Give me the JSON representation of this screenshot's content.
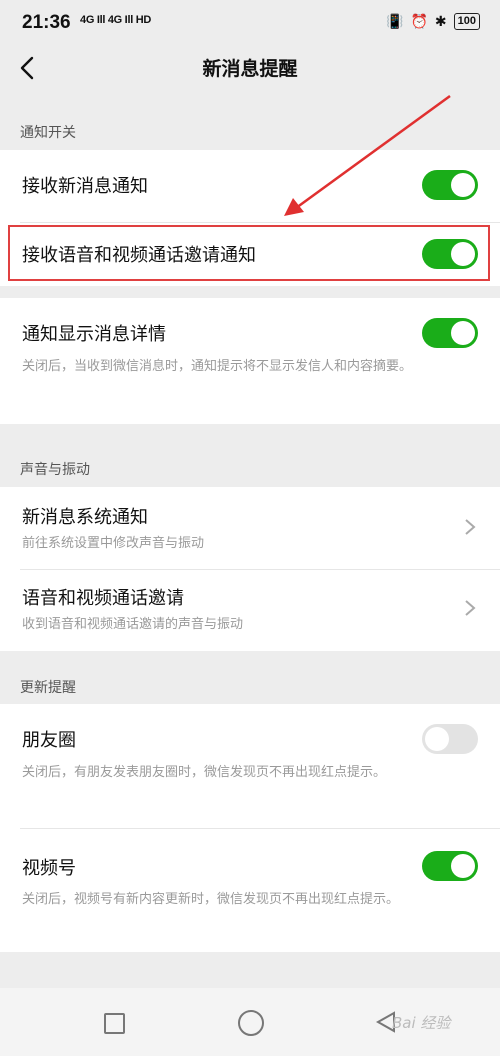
{
  "status_bar": {
    "time": "21:36",
    "signal": "4G Ill 4G Ill HD",
    "battery": "100"
  },
  "header": {
    "title": "新消息提醒"
  },
  "sections": {
    "notifications": {
      "label": "通知开关",
      "items": [
        {
          "title": "接收新消息通知",
          "toggle": "on"
        },
        {
          "title": "接收语音和视频通话邀请通知",
          "toggle": "on"
        },
        {
          "title": "通知显示消息详情",
          "subtitle": "关闭后，当收到微信消息时，通知提示将不显示发信人和内容摘要。",
          "toggle": "on"
        }
      ]
    },
    "sound": {
      "label": "声音与振动",
      "items": [
        {
          "title": "新消息系统通知",
          "subtitle": "前往系统设置中修改声音与振动"
        },
        {
          "title": "语音和视频通话邀请",
          "subtitle": "收到语音和视频通话邀请的声音与振动"
        }
      ]
    },
    "updates": {
      "label": "更新提醒",
      "items": [
        {
          "title": "朋友圈",
          "subtitle": "关闭后，有朋友发表朋友圈时，微信发现页不再出现红点提示。",
          "toggle": "off"
        },
        {
          "title": "视频号",
          "subtitle": "关闭后，视频号有新内容更新时，微信发现页不再出现红点提示。",
          "toggle": "on"
        }
      ]
    }
  },
  "watermark": "Bai 经验",
  "colors": {
    "toggle_on": "#1aad19",
    "highlight": "#e04040",
    "arrow": "#e03030"
  }
}
